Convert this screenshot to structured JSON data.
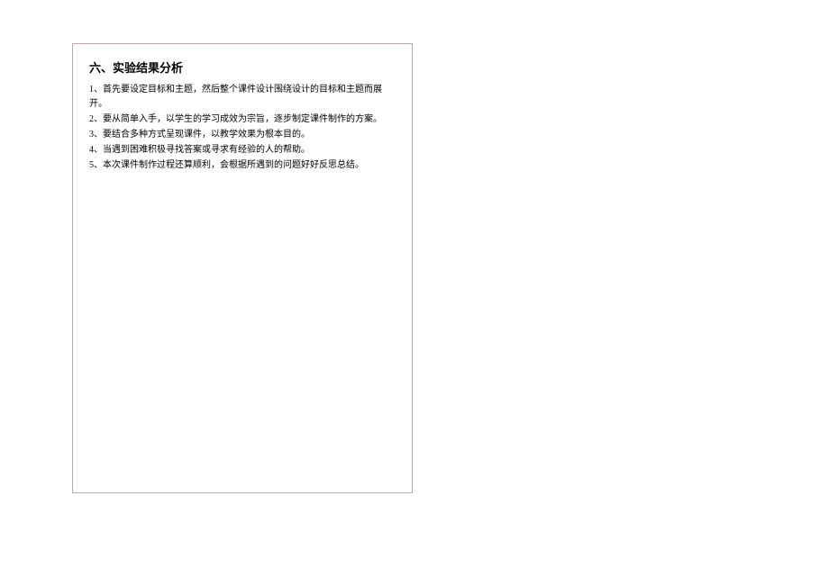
{
  "section": {
    "title": "六、实验结果分析",
    "items": [
      "1、首先要设定目标和主题，然后整个课件设计围绕设计的目标和主题而展开。",
      "2、要从简单入手，以学生的学习成效为宗旨，逐步制定课件制作的方案。",
      "3、要结合多种方式呈现课件，以教学效果为根本目的。",
      "4、当遇到困难积极寻找答案或寻求有经验的人的帮助。",
      "5、本次课件制作过程还算顺利，会根据所遇到的问题好好反思总结。"
    ]
  }
}
